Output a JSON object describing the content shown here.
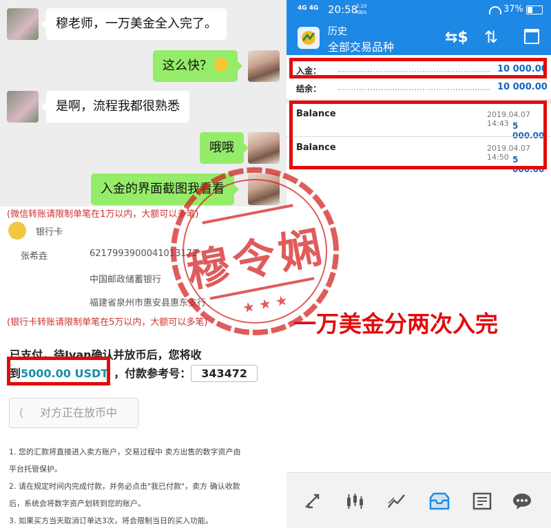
{
  "chat": {
    "messages": [
      {
        "side": "left",
        "text": "穆老师，一万美金全入完了。"
      },
      {
        "side": "right",
        "text": "这么快？"
      },
      {
        "side": "left",
        "text": "是啊，流程我都很熟悉"
      },
      {
        "side": "right",
        "text": "哦哦"
      },
      {
        "side": "right",
        "text": "入金的界面截图我看看"
      }
    ]
  },
  "payment": {
    "wechat_note": "(微信转账请限制单笔在1万以内，大额可以多笔)",
    "bank_label": "银行卡",
    "payee_name": "张希垚",
    "account_number": "6217993900041013172",
    "bank_name": "中国邮政储蓄银行",
    "branch": "福建省泉州市惠安县惠东支行",
    "bank_note": "(银行卡转账请限制单笔在5万以内，大额可以多笔)",
    "paid_line1": "已支付，待Ivan确认并放币后，您将收",
    "paid_to": "到",
    "amount": "5000.00 USDT",
    "ref_label": "，付款参考号：",
    "ref_number": "343472",
    "wait_button": "对方正在放币中",
    "notes": [
      "1. 您的汇款将直接进入卖方账户，交易过程中 卖方出售的数字资产由",
      "平台托管保护。",
      "2. 请在规定时间内完成付款，并务必点击\"我已付款\"，卖方 确认收款",
      "后，系统会将数字资产划转到您的账户。",
      "3. 如果买方当天取消订单达3次，将会限制当日的买入功能。"
    ]
  },
  "stamp": {
    "text": "穆令娴"
  },
  "statusbar": {
    "signal": "4G 4G",
    "time": "20:58",
    "speed": "2.10 KB/s",
    "battery": "37%"
  },
  "app": {
    "title": "历史",
    "subtitle": "全部交易品种",
    "deposit_label": "入金：",
    "deposit_value": "10 000.00",
    "balance_label": "结余：",
    "balance_value": "10 000.00",
    "entries": [
      {
        "title": "Balance",
        "date": "2019.04.07 14:43",
        "amount": "5 000.00"
      },
      {
        "title": "Balance",
        "date": "2019.04.07 14:50",
        "amount": "5 000.00"
      }
    ]
  },
  "caption": "一万美金分两次入完",
  "colors": {
    "wechat_green": "#95ec69",
    "app_blue": "#1e88e5",
    "highlight_red": "#e20b0b",
    "usdt_teal": "#1b8ea0"
  }
}
